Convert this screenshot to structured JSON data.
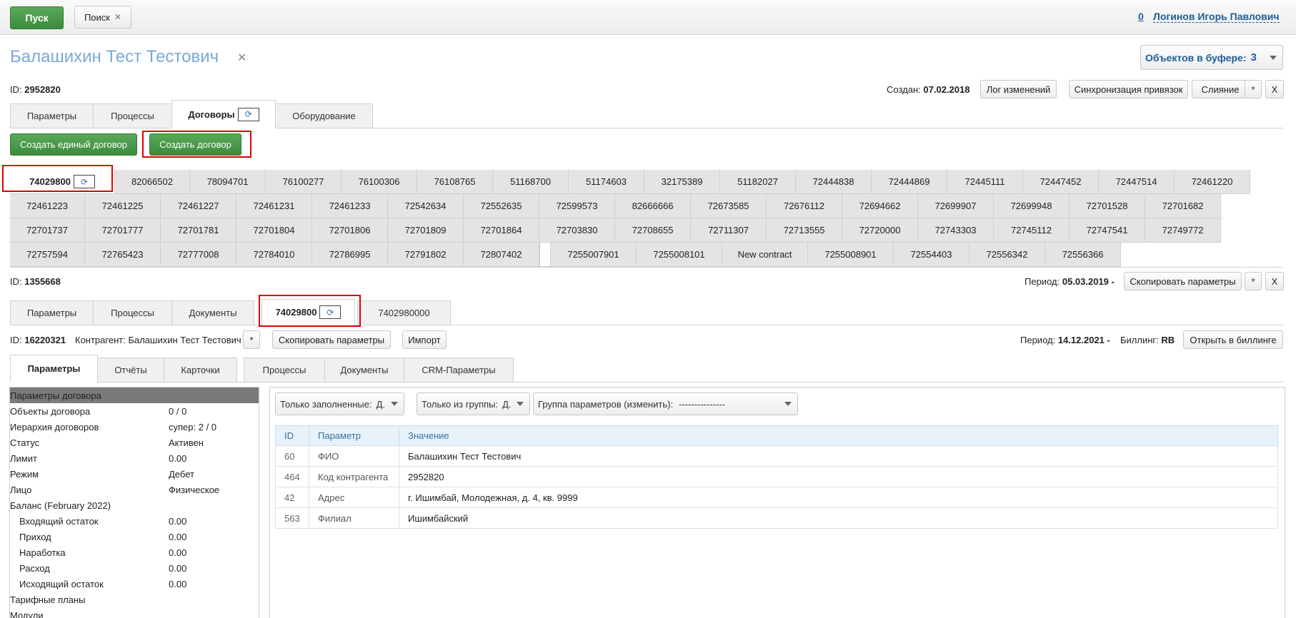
{
  "topbar": {
    "start_label": "Пуск",
    "search_label": "Поиск",
    "counter": "0",
    "user_name": "Логинов Игорь Павлович"
  },
  "customer": {
    "title": "Балашихин Тест Тестович",
    "id_label": "ID:",
    "id_value": "2952820",
    "buffer_label": "Объектов в буфере:",
    "buffer_count": "3",
    "created_label": "Создан:",
    "created_value": "07.02.2018",
    "buttons": {
      "log": "Лог изменений",
      "sync": "Синхронизация привязок",
      "merge": "Слияние",
      "star": "*",
      "close": "X"
    },
    "tabs": [
      "Параметры",
      "Процессы",
      "Договоры",
      "Оборудование"
    ],
    "create_single": "Создать единый договор",
    "create_contract": "Создать договор"
  },
  "contracts": {
    "row1": [
      "74029800",
      "82066502",
      "78094701",
      "76100277",
      "76100306",
      "76108765",
      "51168700",
      "51174603",
      "32175389",
      "51182027",
      "72444838",
      "72444869",
      "72445111",
      "72447452",
      "72447514",
      "72461220"
    ],
    "row2": [
      "72461223",
      "72461225",
      "72461227",
      "72461231",
      "72461233",
      "72542634",
      "72552635",
      "72599573",
      "82666666",
      "72673585",
      "72676112",
      "72694662",
      "72699907",
      "72699948",
      "72701528",
      "72701682"
    ],
    "row3": [
      "72701737",
      "72701777",
      "72701781",
      "72701804",
      "72701806",
      "72701809",
      "72701864",
      "72703830",
      "72708655",
      "72711307",
      "72713555",
      "72720000",
      "72743303",
      "72745112",
      "72747541",
      "72749772"
    ],
    "row4": [
      "72757594",
      "72765423",
      "72777008",
      "72784010",
      "72786995",
      "72791802",
      "72807402",
      "",
      "7255007901",
      "7255008101",
      "New contract",
      "7255008901",
      "72554403",
      "72556342",
      "72556366"
    ]
  },
  "contract": {
    "id_label": "ID:",
    "id_value": "1355668",
    "period_label": "Период:",
    "period_value": "05.03.2019 -",
    "copy_params": "Скопировать параметры",
    "star": "*",
    "close": "X",
    "tabs": [
      "Параметры",
      "Процессы",
      "Документы",
      "74029800",
      "7402980000"
    ]
  },
  "sub": {
    "id_label": "ID:",
    "id_value": "16220321",
    "contractor_label": "Контрагент:",
    "contractor_value": "Балашихин Тест Тестович",
    "star": "*",
    "copy_params": "Скопировать параметры",
    "import": "Импорт",
    "period_label": "Период:",
    "period_value": "14.12.2021 -",
    "billing_label": "Биллинг:",
    "billing_value": "RB",
    "open_billing": "Открыть в биллинге",
    "tabs_left": [
      "Параметры",
      "Отчёты",
      "Карточки"
    ],
    "tabs_right": [
      "Процессы",
      "Документы",
      "CRM-Параметры"
    ]
  },
  "left_panel": {
    "header": "Параметры договора",
    "rows": [
      {
        "k": "Объекты договора",
        "v": "0 / 0",
        "indent": false
      },
      {
        "k": "Иерархия договоров",
        "v": "супер: 2 / 0",
        "indent": false
      },
      {
        "k": "Статус",
        "v": "Активен",
        "indent": false
      },
      {
        "k": "Лимит",
        "v": "0.00",
        "indent": false
      },
      {
        "k": "Режим",
        "v": "Дебет",
        "indent": false
      },
      {
        "k": "Лицо",
        "v": "Физическое",
        "indent": false
      },
      {
        "k": "Баланс (February 2022)",
        "v": "",
        "indent": false
      },
      {
        "k": "Входящий остаток",
        "v": "0.00",
        "indent": true
      },
      {
        "k": "Приход",
        "v": "0.00",
        "indent": true
      },
      {
        "k": "Наработка",
        "v": "0.00",
        "indent": true
      },
      {
        "k": "Расход",
        "v": "0.00",
        "indent": true
      },
      {
        "k": "Исходящий остаток",
        "v": "0.00",
        "indent": true
      },
      {
        "k": "Тарифные планы",
        "v": "",
        "indent": false
      },
      {
        "k": "Модули",
        "v": "",
        "indent": false
      }
    ]
  },
  "filters": {
    "only_filled": "Только заполненные:",
    "only_filled_val": "Д.",
    "only_group": "Только из группы:",
    "only_group_val": "Д.",
    "group_label": "Группа параметров (изменить):",
    "group_val": "---------------"
  },
  "params_table": {
    "headers": [
      "ID",
      "Параметр",
      "Значение"
    ],
    "rows": [
      [
        "60",
        "ФИО",
        "Балашихин Тест Тестович"
      ],
      [
        "464",
        "Код контрагента",
        "2952820"
      ],
      [
        "42",
        "Адрес",
        "г. Ишимбай, Молодежная, д. 4, кв. 9999"
      ],
      [
        "563",
        "Филиал",
        "Ишимбайский"
      ]
    ]
  },
  "icons": {
    "refresh": "⟳",
    "close_x": "✕"
  }
}
